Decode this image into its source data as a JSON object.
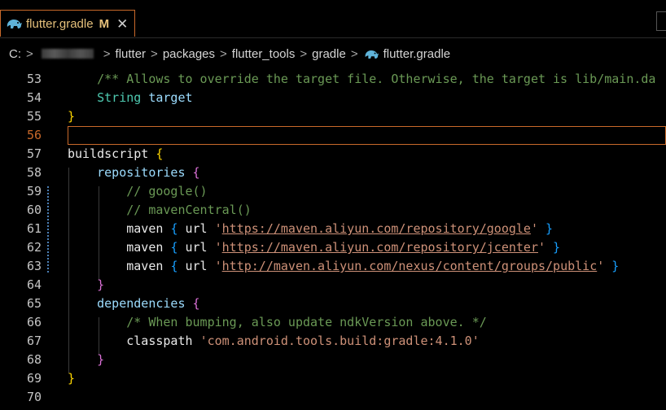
{
  "tab": {
    "name": "flutter.gradle",
    "modified": "M",
    "close": "✕"
  },
  "breadcrumb": {
    "drive": "C:",
    "parts": [
      "flutter",
      "packages",
      "flutter_tools",
      "gradle"
    ],
    "file": "flutter.gradle"
  },
  "lines": [
    {
      "n": "53",
      "segs": [
        {
          "c": "cm",
          "t": "    /** Allows to override the target file. Otherwise, the target is lib/main.da"
        }
      ]
    },
    {
      "n": "54",
      "segs": [
        {
          "c": "ty",
          "t": "    String"
        },
        {
          "c": "wh",
          "t": " "
        },
        {
          "c": "id",
          "t": "target"
        }
      ]
    },
    {
      "n": "55",
      "segs": [
        {
          "c": "br1",
          "t": "}"
        }
      ]
    },
    {
      "n": "56",
      "segs": []
    },
    {
      "n": "57",
      "segs": [
        {
          "c": "wh",
          "t": "buildscript "
        },
        {
          "c": "br1",
          "t": "{"
        }
      ]
    },
    {
      "n": "58",
      "segs": [
        {
          "c": "wh",
          "t": "    "
        },
        {
          "c": "id",
          "t": "repositories"
        },
        {
          "c": "wh",
          "t": " "
        },
        {
          "c": "br2",
          "t": "{"
        }
      ]
    },
    {
      "n": "59",
      "segs": [
        {
          "c": "cm",
          "t": "        // google()"
        }
      ]
    },
    {
      "n": "60",
      "segs": [
        {
          "c": "cm",
          "t": "        // mavenCentral()"
        }
      ]
    },
    {
      "n": "61",
      "segs": [
        {
          "c": "wh",
          "t": "        maven "
        },
        {
          "c": "br3",
          "t": "{"
        },
        {
          "c": "wh",
          "t": " url "
        },
        {
          "c": "str",
          "t": "'"
        },
        {
          "c": "url",
          "t": "https://maven.aliyun.com/repository/google"
        },
        {
          "c": "str",
          "t": "'"
        },
        {
          "c": "wh",
          "t": " "
        },
        {
          "c": "br3",
          "t": "}"
        }
      ]
    },
    {
      "n": "62",
      "segs": [
        {
          "c": "wh",
          "t": "        maven "
        },
        {
          "c": "br3",
          "t": "{"
        },
        {
          "c": "wh",
          "t": " url "
        },
        {
          "c": "str",
          "t": "'"
        },
        {
          "c": "url",
          "t": "https://maven.aliyun.com/repository/jcenter"
        },
        {
          "c": "str",
          "t": "'"
        },
        {
          "c": "wh",
          "t": " "
        },
        {
          "c": "br3",
          "t": "}"
        }
      ]
    },
    {
      "n": "63",
      "segs": [
        {
          "c": "wh",
          "t": "        maven "
        },
        {
          "c": "br3",
          "t": "{"
        },
        {
          "c": "wh",
          "t": " url "
        },
        {
          "c": "str",
          "t": "'"
        },
        {
          "c": "url",
          "t": "http://maven.aliyun.com/nexus/content/groups/public"
        },
        {
          "c": "str",
          "t": "'"
        },
        {
          "c": "wh",
          "t": " "
        },
        {
          "c": "br3",
          "t": "}"
        }
      ]
    },
    {
      "n": "64",
      "segs": [
        {
          "c": "wh",
          "t": "    "
        },
        {
          "c": "br2",
          "t": "}"
        }
      ]
    },
    {
      "n": "65",
      "segs": [
        {
          "c": "wh",
          "t": "    "
        },
        {
          "c": "id",
          "t": "dependencies"
        },
        {
          "c": "wh",
          "t": " "
        },
        {
          "c": "br2",
          "t": "{"
        }
      ]
    },
    {
      "n": "66",
      "segs": [
        {
          "c": "cm",
          "t": "        /* When bumping, also update ndkVersion above. */"
        }
      ]
    },
    {
      "n": "67",
      "segs": [
        {
          "c": "wh",
          "t": "        classpath "
        },
        {
          "c": "str",
          "t": "'com.android.tools.build:gradle:4.1.0'"
        }
      ]
    },
    {
      "n": "68",
      "segs": [
        {
          "c": "wh",
          "t": "    "
        },
        {
          "c": "br2",
          "t": "}"
        }
      ]
    },
    {
      "n": "69",
      "segs": [
        {
          "c": "br1",
          "t": "}"
        }
      ]
    },
    {
      "n": "70",
      "segs": []
    }
  ],
  "current_line": "56",
  "colors": {
    "accent": "#c9692a",
    "comment": "#6a9955",
    "string": "#ce9178",
    "type": "#4ec9b0"
  }
}
